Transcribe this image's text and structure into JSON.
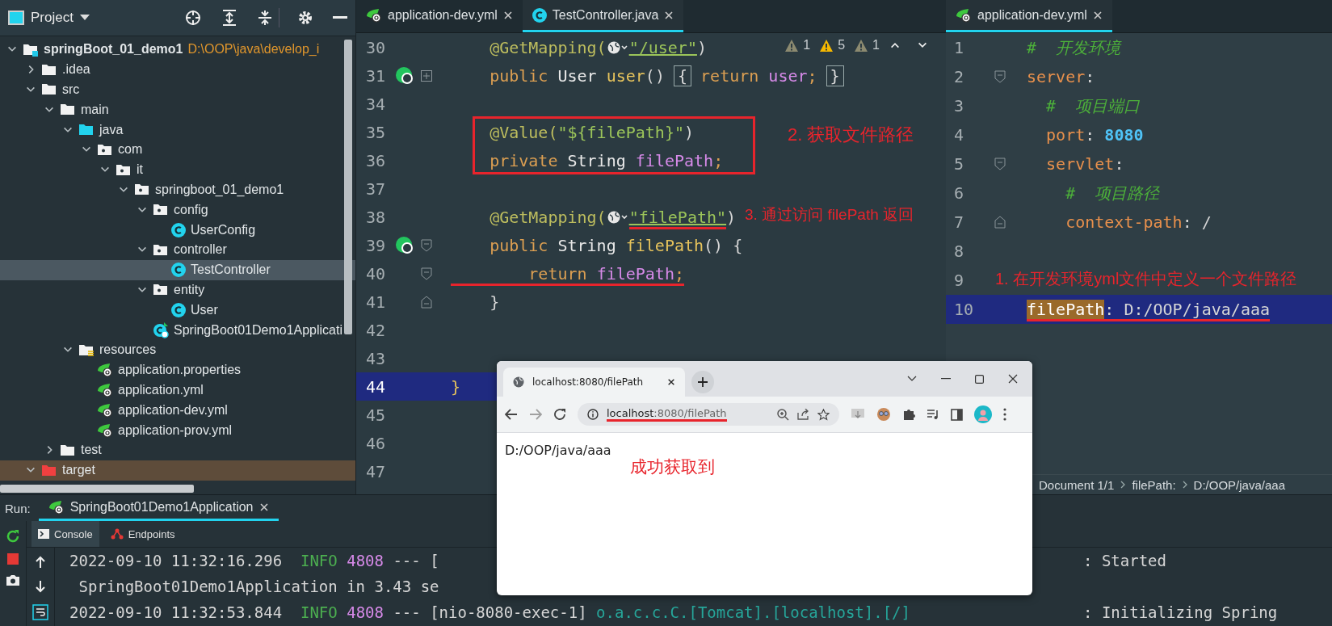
{
  "project_panel": {
    "title": "Project",
    "tree": [
      {
        "label": "springBoot_01_demo1",
        "path": "D:\\OOP\\java\\develop_i",
        "kind": "module",
        "expanded": true,
        "selected": false,
        "children": [
          {
            "label": ".idea",
            "kind": "folder",
            "expanded": false,
            "selected": false
          },
          {
            "label": "src",
            "kind": "folder",
            "expanded": true,
            "selected": false,
            "children": [
              {
                "label": "main",
                "kind": "folder",
                "expanded": true,
                "selected": false,
                "children": [
                  {
                    "label": "java",
                    "kind": "source",
                    "expanded": true,
                    "selected": false,
                    "children": [
                      {
                        "label": "com",
                        "kind": "package",
                        "expanded": true,
                        "selected": false,
                        "children": [
                          {
                            "label": "it",
                            "kind": "package",
                            "expanded": true,
                            "selected": false,
                            "children": [
                              {
                                "label": "springboot_01_demo1",
                                "kind": "package",
                                "expanded": true,
                                "selected": false,
                                "children": [
                                  {
                                    "label": "config",
                                    "kind": "package",
                                    "expanded": true,
                                    "selected": false,
                                    "children": [
                                      {
                                        "label": "UserConfig",
                                        "kind": "class",
                                        "selected": false
                                      }
                                    ]
                                  },
                                  {
                                    "label": "controller",
                                    "kind": "package",
                                    "expanded": true,
                                    "selected": false,
                                    "children": [
                                      {
                                        "label": "TestController",
                                        "kind": "class",
                                        "selected": true
                                      }
                                    ]
                                  },
                                  {
                                    "label": "entity",
                                    "kind": "package",
                                    "expanded": true,
                                    "selected": false,
                                    "children": [
                                      {
                                        "label": "User",
                                        "kind": "class",
                                        "selected": false
                                      }
                                    ]
                                  },
                                  {
                                    "label": "SpringBoot01Demo1Applicati",
                                    "kind": "app",
                                    "selected": false
                                  }
                                ]
                              }
                            ]
                          }
                        ]
                      }
                    ]
                  },
                  {
                    "label": "resources",
                    "kind": "resources",
                    "expanded": true,
                    "selected": false,
                    "children": [
                      {
                        "label": "application.properties",
                        "kind": "config",
                        "selected": false
                      },
                      {
                        "label": "application.yml",
                        "kind": "config",
                        "selected": false
                      },
                      {
                        "label": "application-dev.yml",
                        "kind": "config",
                        "selected": false
                      },
                      {
                        "label": "application-prov.yml",
                        "kind": "config",
                        "selected": false
                      }
                    ]
                  }
                ]
              },
              {
                "label": "test",
                "kind": "folder",
                "expanded": false,
                "selected": false
              }
            ]
          },
          {
            "label": "target",
            "kind": "excluded",
            "expanded": true,
            "selected": false
          }
        ]
      }
    ]
  },
  "editor": {
    "tabs": [
      {
        "label": "application-dev.yml",
        "kind": "config",
        "selected": false
      },
      {
        "label": "TestController.java",
        "kind": "class",
        "selected": true
      }
    ],
    "inspections": [
      {
        "count": "1",
        "kind": "weak"
      },
      {
        "count": "5",
        "kind": "warning"
      },
      {
        "count": "1",
        "kind": "weak"
      }
    ],
    "lines": [
      {
        "no": "30",
        "current": false,
        "tokens": [
          {
            "t": "    @GetMapping(",
            "kind": "ann"
          },
          {
            "kind": "globe"
          },
          {
            "t": "\"/user\"",
            "kind": "str-link"
          },
          {
            "t": ")",
            "kind": "plain"
          }
        ]
      },
      {
        "no": "31",
        "current": false,
        "gutter": {
          "kind": "endpoint"
        },
        "fold": {
          "kind": "plus"
        },
        "tokens": [
          {
            "t": "    public ",
            "kind": "kw"
          },
          {
            "t": "User ",
            "kind": "type"
          },
          {
            "t": "user",
            "kind": "method"
          },
          {
            "t": "() ",
            "kind": "plain"
          },
          {
            "t": "{",
            "kind": "brace-box"
          },
          {
            "t": " return ",
            "kind": "kw"
          },
          {
            "t": "user",
            "kind": "field"
          },
          {
            "t": "; ",
            "kind": "kw"
          },
          {
            "t": "}",
            "kind": "brace-box"
          }
        ]
      },
      {
        "no": "34",
        "current": false
      },
      {
        "no": "35",
        "current": false,
        "tokens": [
          {
            "t": "    @Value(",
            "kind": "ann"
          },
          {
            "t": "\"${filePath}\"",
            "kind": "str"
          },
          {
            "t": ")",
            "kind": "plain"
          }
        ]
      },
      {
        "no": "36",
        "current": false,
        "tokens": [
          {
            "t": "    private ",
            "kind": "kw"
          },
          {
            "t": "String ",
            "kind": "type"
          },
          {
            "t": "filePath",
            "kind": "field"
          },
          {
            "t": ";",
            "kind": "kw"
          }
        ]
      },
      {
        "no": "37",
        "current": false
      },
      {
        "no": "38",
        "current": false,
        "tokens": [
          {
            "t": "    @GetMapping(",
            "kind": "ann"
          },
          {
            "kind": "globe"
          },
          {
            "t": "\"filePath\"",
            "kind": "str-link",
            "marked": true
          },
          {
            "t": ")",
            "kind": "plain"
          }
        ]
      },
      {
        "no": "39",
        "current": false,
        "gutter": {
          "kind": "endpoint"
        },
        "fold": {
          "kind": "start"
        },
        "tokens": [
          {
            "t": "    public ",
            "kind": "kw"
          },
          {
            "t": "String ",
            "kind": "type"
          },
          {
            "t": "filePath",
            "kind": "method"
          },
          {
            "t": "() {",
            "kind": "plain"
          }
        ]
      },
      {
        "no": "40",
        "current": false,
        "fold": {
          "kind": "start"
        },
        "tokens": [
          {
            "t": "        return ",
            "kind": "kw",
            "marked": true
          },
          {
            "t": "filePath",
            "kind": "field",
            "marked": true
          },
          {
            "t": ";",
            "kind": "kw",
            "marked": true
          }
        ]
      },
      {
        "no": "41",
        "current": false,
        "fold": {
          "kind": "end"
        },
        "tokens": [
          {
            "t": "    }",
            "kind": "plain"
          }
        ]
      },
      {
        "no": "42",
        "current": false
      },
      {
        "no": "43",
        "current": false
      },
      {
        "no": "44",
        "current": true,
        "tokens": [
          {
            "t": "}",
            "kind": "brace"
          }
        ]
      },
      {
        "no": "45",
        "current": false
      },
      {
        "no": "46",
        "current": false
      },
      {
        "no": "47",
        "current": false
      }
    ],
    "annotations": [
      "2. 获取文件路径",
      "3. 通过访问 filePath 返回"
    ]
  },
  "yaml_editor": {
    "tabs": [
      {
        "label": "application-dev.yml",
        "kind": "config",
        "selected": true
      }
    ],
    "lines": [
      {
        "no": "1",
        "current": false,
        "tokens": [
          {
            "t": "#  开发环境",
            "kind": "comment"
          }
        ]
      },
      {
        "no": "2",
        "current": false,
        "fold": {
          "kind": "start"
        },
        "tokens": [
          {
            "t": "server",
            "kind": "key"
          },
          {
            "t": ":",
            "kind": "plain"
          }
        ]
      },
      {
        "no": "3",
        "current": false,
        "tokens": [
          {
            "t": "  #  项目端口",
            "kind": "comment"
          }
        ]
      },
      {
        "no": "4",
        "current": false,
        "tokens": [
          {
            "t": "  port",
            "kind": "key"
          },
          {
            "t": ": ",
            "kind": "plain"
          },
          {
            "t": "8080",
            "kind": "num"
          }
        ]
      },
      {
        "no": "5",
        "current": false,
        "fold": {
          "kind": "start"
        },
        "tokens": [
          {
            "t": "  servlet",
            "kind": "key"
          },
          {
            "t": ":",
            "kind": "plain"
          }
        ]
      },
      {
        "no": "6",
        "current": false,
        "tokens": [
          {
            "t": "    #  项目路径",
            "kind": "comment"
          }
        ]
      },
      {
        "no": "7",
        "current": false,
        "fold": {
          "kind": "end"
        },
        "tokens": [
          {
            "t": "    context-path",
            "kind": "key"
          },
          {
            "t": ": /",
            "kind": "plain"
          }
        ]
      },
      {
        "no": "8",
        "current": false
      },
      {
        "no": "9",
        "current": false
      },
      {
        "no": "10",
        "current": true,
        "tokens": [
          {
            "t": "filePath",
            "kind": "key-hl",
            "marked": true
          },
          {
            "t": ": D:/OOP/java/aaa",
            "kind": "plain",
            "marked": true
          }
        ]
      }
    ],
    "annotation": "1. 在开发环境yml文件中定义一个文件路径",
    "breadcrumbs": [
      "Document 1/1",
      "filePath:",
      "D:/OOP/java/aaa"
    ]
  },
  "browser": {
    "tab_title": "localhost:8080/filePath",
    "host": "localhost",
    "path": ":8080/filePath",
    "url_marked": true,
    "back_disabled": false,
    "forward_disabled": true,
    "content": "D:/OOP/java/aaa",
    "annotation": "成功获取到"
  },
  "run_panel": {
    "label": "Run:",
    "tabs": [
      {
        "label": "SpringBoot01Demo1Application",
        "kind": "config",
        "selected": true
      }
    ],
    "subtabs": [
      {
        "label": "Console",
        "kind": "console",
        "selected": true
      },
      {
        "label": "Endpoints",
        "kind": "endpoints",
        "selected": false
      }
    ],
    "console": [
      {
        "left": [
          {
            "t": "2022-09-10 11:32:16.296  ",
            "kind": "plain"
          },
          {
            "t": "INFO ",
            "kind": "info"
          },
          {
            "t": "4808",
            "kind": "pid"
          },
          {
            "t": " --- [",
            "kind": "plain"
          }
        ],
        "right": [
          {
            "t": ": Started",
            "kind": "plain"
          }
        ]
      },
      {
        "left": [
          {
            "t": " SpringBoot01Demo1Application in 3.43 se",
            "kind": "plain"
          }
        ]
      },
      {
        "left": [
          {
            "t": "2022-09-10 11:32:53.844  ",
            "kind": "plain"
          },
          {
            "t": "INFO ",
            "kind": "info"
          },
          {
            "t": "4808",
            "kind": "pid"
          },
          {
            "t": " --- [nio-8080-exec-1] ",
            "kind": "plain"
          },
          {
            "t": "o.a.c.c.C.[Tomcat].[localhost].[/]",
            "kind": "logger"
          }
        ],
        "right": [
          {
            "t": ": Initializing Spring",
            "kind": "plain"
          }
        ]
      }
    ]
  }
}
